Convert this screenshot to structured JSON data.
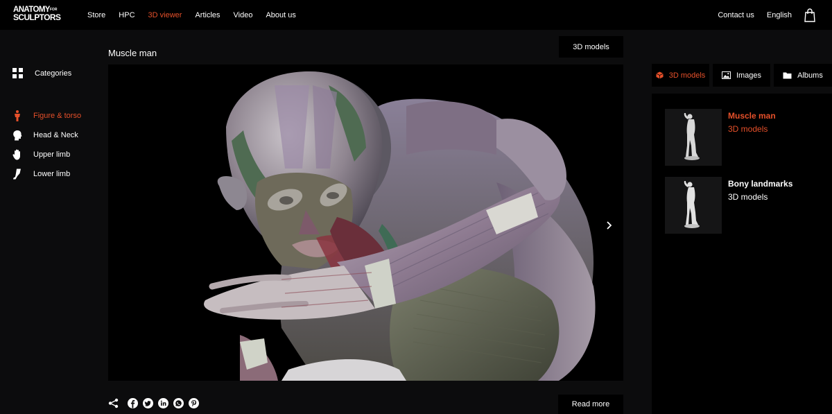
{
  "header": {
    "logo_line1": "ANATOMY",
    "logo_small": "FOR",
    "logo_line2": "SCULPTORS",
    "nav": [
      {
        "label": "Store"
      },
      {
        "label": "HPC"
      },
      {
        "label": "3D viewer"
      },
      {
        "label": "Articles"
      },
      {
        "label": "Video"
      },
      {
        "label": "About us"
      }
    ],
    "contact_label": "Contact us",
    "language_label": "English",
    "cart_icon": "shopping-bag-icon"
  },
  "sidebar": {
    "categories_label": "Categories",
    "items": [
      {
        "label": "Figure & torso",
        "icon": "figure-icon"
      },
      {
        "label": "Head & Neck",
        "icon": "head-icon"
      },
      {
        "label": "Upper limb",
        "icon": "hand-icon"
      },
      {
        "label": "Lower limb",
        "icon": "leg-icon"
      }
    ]
  },
  "main": {
    "title": "Muscle man",
    "models_button": "3D models",
    "read_more": "Read more",
    "share_icons": [
      "share-icon",
      "facebook-icon",
      "twitter-icon",
      "linkedin-icon",
      "whatsapp-icon",
      "pinterest-icon"
    ]
  },
  "right": {
    "tabs": [
      {
        "label": "3D models",
        "icon": "cube-icon"
      },
      {
        "label": "Images",
        "icon": "image-icon"
      },
      {
        "label": "Albums",
        "icon": "folder-icon"
      }
    ],
    "cards": [
      {
        "name": "Muscle man",
        "sub": "3D models"
      },
      {
        "name": "Bony landmarks",
        "sub": "3D models"
      }
    ]
  },
  "colors": {
    "accent": "#e6502a",
    "background": "#0c0c0d",
    "panel": "#000000"
  }
}
